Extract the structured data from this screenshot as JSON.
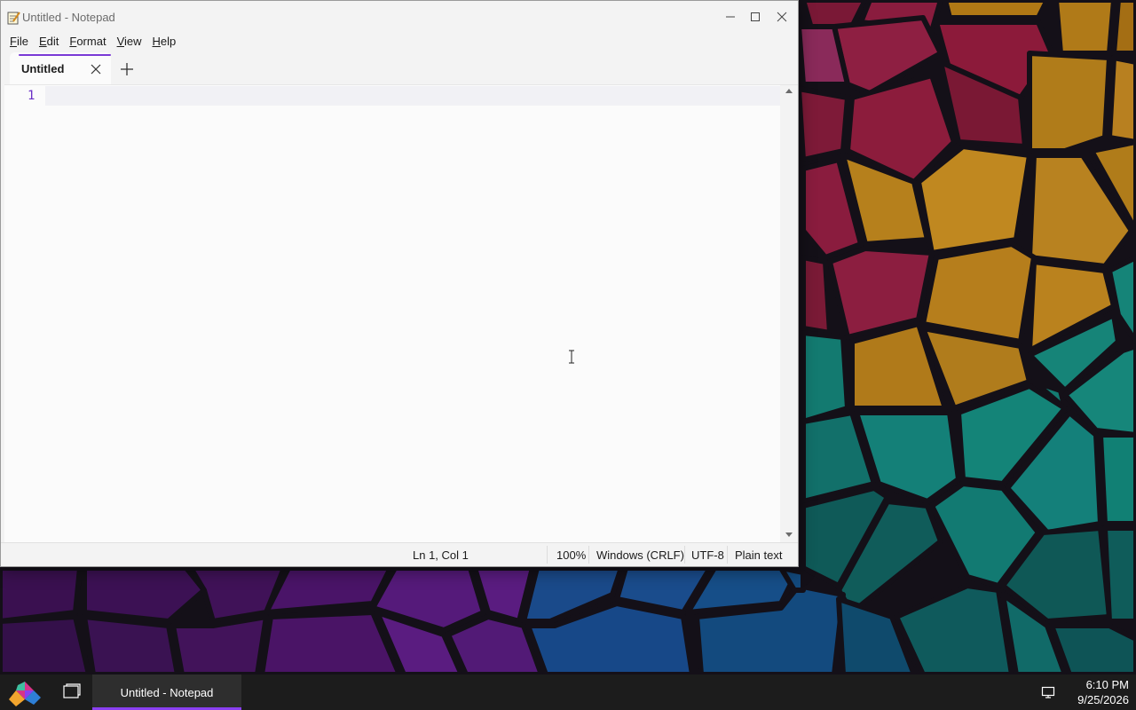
{
  "window": {
    "title": "Untitled - Notepad",
    "controls": {
      "minimize": "minimize-icon",
      "maximize": "maximize-icon",
      "close": "close-icon"
    }
  },
  "menu": {
    "items": [
      {
        "label": "File",
        "mnemonic": "F",
        "rest": "ile"
      },
      {
        "label": "Edit",
        "mnemonic": "E",
        "rest": "dit"
      },
      {
        "label": "Format",
        "mnemonic": "F",
        "rest": "ormat"
      },
      {
        "label": "View",
        "mnemonic": "V",
        "rest": "iew"
      },
      {
        "label": "Help",
        "mnemonic": "H",
        "rest": "elp"
      }
    ]
  },
  "tabs": {
    "items": [
      {
        "label": "Untitled",
        "active": true
      }
    ],
    "new_tab_icon": "plus-icon"
  },
  "editor": {
    "line_numbers": [
      "1"
    ],
    "content": ""
  },
  "status": {
    "position": "Ln 1, Col 1",
    "zoom": "100%",
    "line_ending": "Windows (CRLF)",
    "encoding": "UTF-8",
    "format": "Plain text"
  },
  "taskbar": {
    "open_app": "Untitled - Notepad",
    "time": "6:10 PM",
    "date": "9/25/2026"
  },
  "colors": {
    "accent": "#7a3ad6",
    "taskbar_accent": "#8a3ff0",
    "line_number": "#6a2fc6"
  }
}
